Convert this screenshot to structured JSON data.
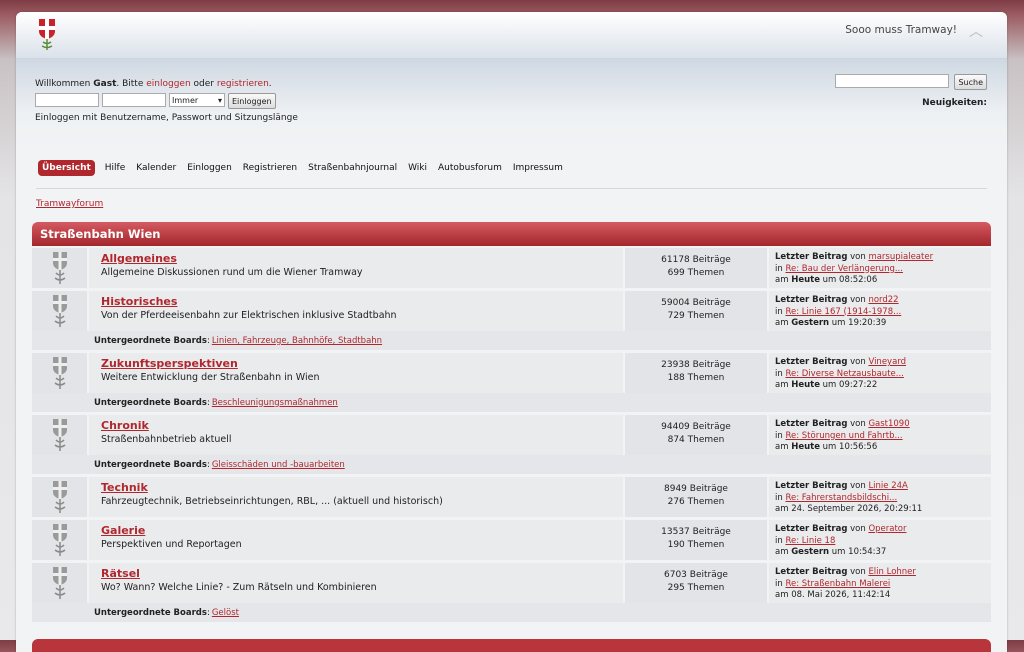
{
  "header": {
    "slogan": "Sooo muss Tramway!"
  },
  "welcome": {
    "prefix": "Willkommen ",
    "guest": "Gast",
    "middle": ". Bitte ",
    "login_link": "einloggen",
    "or": " oder ",
    "register_link": "registrieren",
    "suffix": "."
  },
  "login": {
    "duration": "Immer",
    "button": "Einloggen",
    "hint": "Einloggen mit Benutzername, Passwort und Sitzungslänge"
  },
  "search": {
    "button": "Suche"
  },
  "news": {
    "label": "Neuigkeiten:"
  },
  "menu": [
    "Übersicht",
    "Hilfe",
    "Kalender",
    "Einloggen",
    "Registrieren",
    "Straßenbahnjournal",
    "Wiki",
    "Autobusforum",
    "Impressum"
  ],
  "breadcrumb": "Tramwayforum",
  "category": "Straßenbahn Wien",
  "boards": [
    {
      "name": "Allgemeines",
      "desc": "Allgemeine Diskussionen rund um die Wiener Tramway",
      "posts": "61178 Beiträge",
      "topics": "699 Themen",
      "last_user": "marsupialeater",
      "last_topic": "Re: Bau der Verlängerung...",
      "last_day": "Heute",
      "last_time": "08:52:06",
      "children": ""
    },
    {
      "name": "Historisches",
      "desc": "Von der Pferdeeisenbahn zur Elektrischen inklusive Stadtbahn",
      "posts": "59004 Beiträge",
      "topics": "729 Themen",
      "last_user": "nord22",
      "last_topic": "Re: Linie 167 (1914-1978...",
      "last_day": "Gestern",
      "last_time": "19:20:39",
      "children": "Linien, Fahrzeuge, Bahnhöfe, Stadtbahn"
    },
    {
      "name": "Zukunftsperspektiven",
      "desc": "Weitere Entwicklung der Straßenbahn in Wien",
      "posts": "23938 Beiträge",
      "topics": "188 Themen",
      "last_user": "Vineyard",
      "last_topic": "Re: Diverse Netzausbaute...",
      "last_day": "Heute",
      "last_time": "09:27:22",
      "children": "Beschleunigungsmaßnahmen"
    },
    {
      "name": "Chronik",
      "desc": "Straßenbahnbetrieb aktuell",
      "posts": "94409 Beiträge",
      "topics": "874 Themen",
      "last_user": "Gast1090",
      "last_topic": "Re: Störungen und Fahrtb...",
      "last_day": "Heute",
      "last_time": "10:56:56",
      "children": "Gleisschäden und -bauarbeiten"
    },
    {
      "name": "Technik",
      "desc": "Fahrzeugtechnik, Betriebseinrichtungen, RBL, ... (aktuell und historisch)",
      "posts": "8949 Beiträge",
      "topics": "276 Themen",
      "last_user": "Linie 24A",
      "last_topic": "Re: Fahrerstandsbildschi...",
      "last_day": "24. September 2026, 20:29:11",
      "last_time": "",
      "children": ""
    },
    {
      "name": "Galerie",
      "desc": "Perspektiven und Reportagen",
      "posts": "13537 Beiträge",
      "topics": "190 Themen",
      "last_user": "Operator",
      "last_topic": "Re: Linie 18",
      "last_day": "Gestern",
      "last_time": "10:54:37",
      "children": ""
    },
    {
      "name": "Rätsel",
      "desc": "Wo? Wann? Welche Linie? - Zum Rätseln und Kombinieren",
      "posts": "6703 Beiträge",
      "topics": "295 Themen",
      "last_user": "Elin Lohner",
      "last_topic": "Re: Straßenbahn Malerei",
      "last_day": "08. Mai 2026, 11:42:14",
      "last_time": "",
      "children": "Gelöst"
    }
  ],
  "labels": {
    "last_post": "Letzter Beitrag",
    "by": " von ",
    "in": "in ",
    "on": "am ",
    "at": " um ",
    "subboards": "Untergeordnete Boards"
  },
  "colors": {
    "accent": "#b0272d"
  }
}
